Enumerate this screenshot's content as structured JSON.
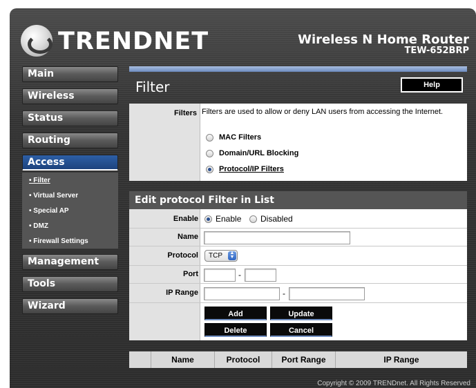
{
  "header": {
    "logo_text": "TRENDNET",
    "product_name": "Wireless N Home Router",
    "model": "TEW-652BRP"
  },
  "sidebar": {
    "items": [
      {
        "label": "Main"
      },
      {
        "label": "Wireless"
      },
      {
        "label": "Status"
      },
      {
        "label": "Routing"
      },
      {
        "label": "Access"
      },
      {
        "label": "Management"
      },
      {
        "label": "Tools"
      },
      {
        "label": "Wizard"
      }
    ],
    "access_submenu": [
      {
        "label": "• Filter"
      },
      {
        "label": "• Virtual Server"
      },
      {
        "label": "• Special AP"
      },
      {
        "label": "• DMZ"
      },
      {
        "label": "• Firewall Settings"
      }
    ]
  },
  "page": {
    "title": "Filter",
    "help_label": "Help"
  },
  "filters_section": {
    "label": "Filters",
    "description": "Filters are used to allow or deny LAN users from accessing the Internet.",
    "options": [
      {
        "label": "MAC Filters",
        "selected": false
      },
      {
        "label": "Domain/URL Blocking",
        "selected": false
      },
      {
        "label": "Protocol/IP Filters",
        "selected": true
      }
    ]
  },
  "edit_section": {
    "title": "Edit protocol Filter in List",
    "enable_label": "Enable",
    "enable_option": "Enable",
    "disable_option": "Disabled",
    "name_label": "Name",
    "name_value": "",
    "protocol_label": "Protocol",
    "protocol_value": "TCP",
    "port_label": "Port",
    "port_from": "",
    "port_to": "",
    "port_separator": "-",
    "ip_range_label": "IP Range",
    "ip_from": "",
    "ip_to": "",
    "ip_separator": "-",
    "buttons": {
      "add": "Add",
      "update": "Update",
      "delete": "Delete",
      "cancel": "Cancel"
    }
  },
  "filter_list": {
    "columns": [
      "Name",
      "Protocol",
      "Port Range",
      "IP Range"
    ]
  },
  "footer": {
    "copyright": "Copyright © 2009 TRENDnet. All Rights Reserved"
  }
}
